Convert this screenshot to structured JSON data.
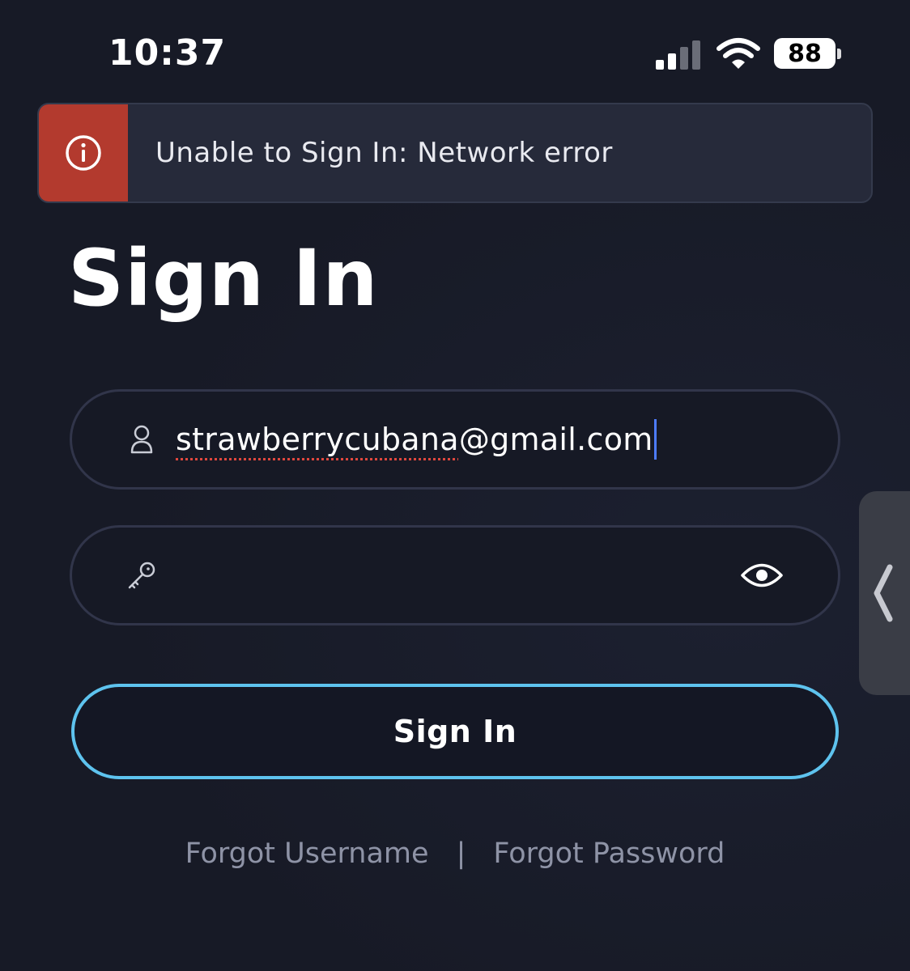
{
  "status_bar": {
    "time": "10:37",
    "battery": "88",
    "icons": [
      "signal-icon",
      "wifi-icon",
      "battery-icon"
    ]
  },
  "error_banner": {
    "message": "Unable to Sign In: Network error",
    "icon": "info-icon",
    "color": "#b33a2e"
  },
  "page": {
    "title": "Sign In"
  },
  "form": {
    "email": {
      "value_misspelled": "strawberrycubana",
      "value_rest": "@gmail.com",
      "icon": "user-icon"
    },
    "password": {
      "value": "",
      "icon": "key-icon",
      "toggle_icon": "eye-icon"
    },
    "submit_label": "Sign In",
    "submit_border_color": "#5ec3ee"
  },
  "links": {
    "forgot_username": "Forgot Username",
    "separator": "|",
    "forgot_password": "Forgot Password"
  },
  "side_handle": {
    "icon": "chevron-left-icon"
  }
}
